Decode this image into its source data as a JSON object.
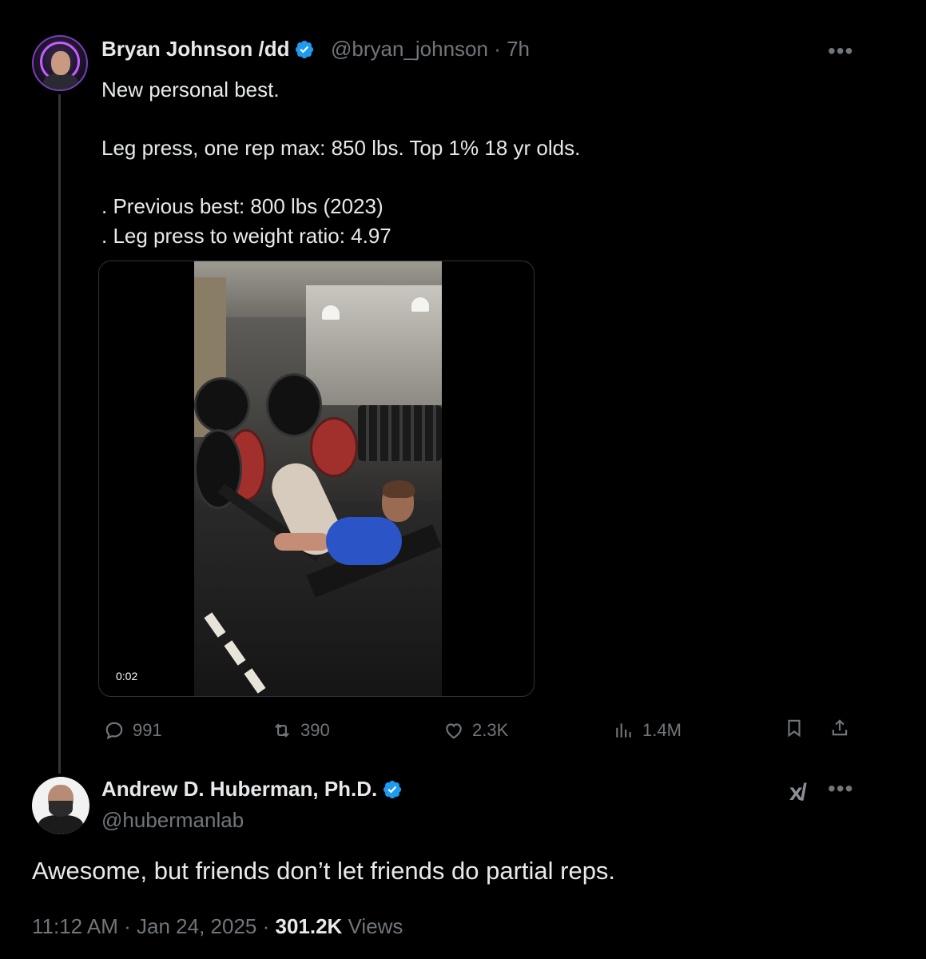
{
  "tweet": {
    "author_name": "Bryan Johnson /dd",
    "handle": "@bryan_johnson",
    "time": "· 7h",
    "text": "New personal best.\n\nLeg press, one rep max: 850 lbs. Top 1% 18 yr olds.\n\n. Previous best: 800 lbs (2023)\n. Leg press to weight ratio: 4.97",
    "video_duration": "0:02",
    "more_icon": "more-horizontal-icon",
    "actions": {
      "replies": "991",
      "reposts": "390",
      "likes": "2.3K",
      "views": "1.4M"
    }
  },
  "reply": {
    "author_name": "Andrew D. Huberman, Ph.D.",
    "handle": "@hubermanlab",
    "text": "Awesome, but friends don’t let friends do partial reps.",
    "time": "11:12 AM · Jan 24, 2025 · ",
    "views_count": "301.2K",
    "views_label": " Views",
    "grok_icon": "grok-icon"
  },
  "colors": {
    "background": "#000000",
    "text": "#e7e9ea",
    "muted": "#71767b",
    "verified": "#1d9bf0",
    "border": "#2f3336"
  }
}
